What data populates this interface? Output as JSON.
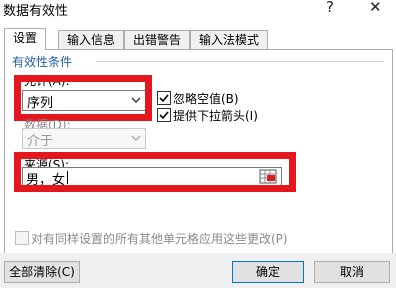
{
  "window": {
    "title": "数据有效性",
    "help_label": "?",
    "close_label": "✕"
  },
  "tabs": [
    {
      "label": "设置",
      "active": true
    },
    {
      "label": "输入信息",
      "active": false
    },
    {
      "label": "出错警告",
      "active": false
    },
    {
      "label": "输入法模式",
      "active": false
    }
  ],
  "criteria": {
    "section_title": "有效性条件",
    "allow_label": "允许(A):",
    "allow_value": "序列",
    "ignore_blank_label": "忽略空值(B)",
    "ignore_blank_checked": true,
    "dropdown_label": "提供下拉箭头(I)",
    "dropdown_checked": true,
    "data_label": "数据(D):",
    "data_value": "介于",
    "source_label": "来源(S):",
    "source_value": "男，女"
  },
  "apply_all": {
    "label": "对有同样设置的所有其他单元格应用这些更改(P)",
    "checked": false
  },
  "buttons": {
    "clear_all": "全部清除(C)",
    "ok": "确定",
    "cancel": "取消"
  },
  "colors": {
    "highlight": "#e3171d",
    "section_title": "#1d5fa8",
    "default_button_border": "#0078d7"
  }
}
